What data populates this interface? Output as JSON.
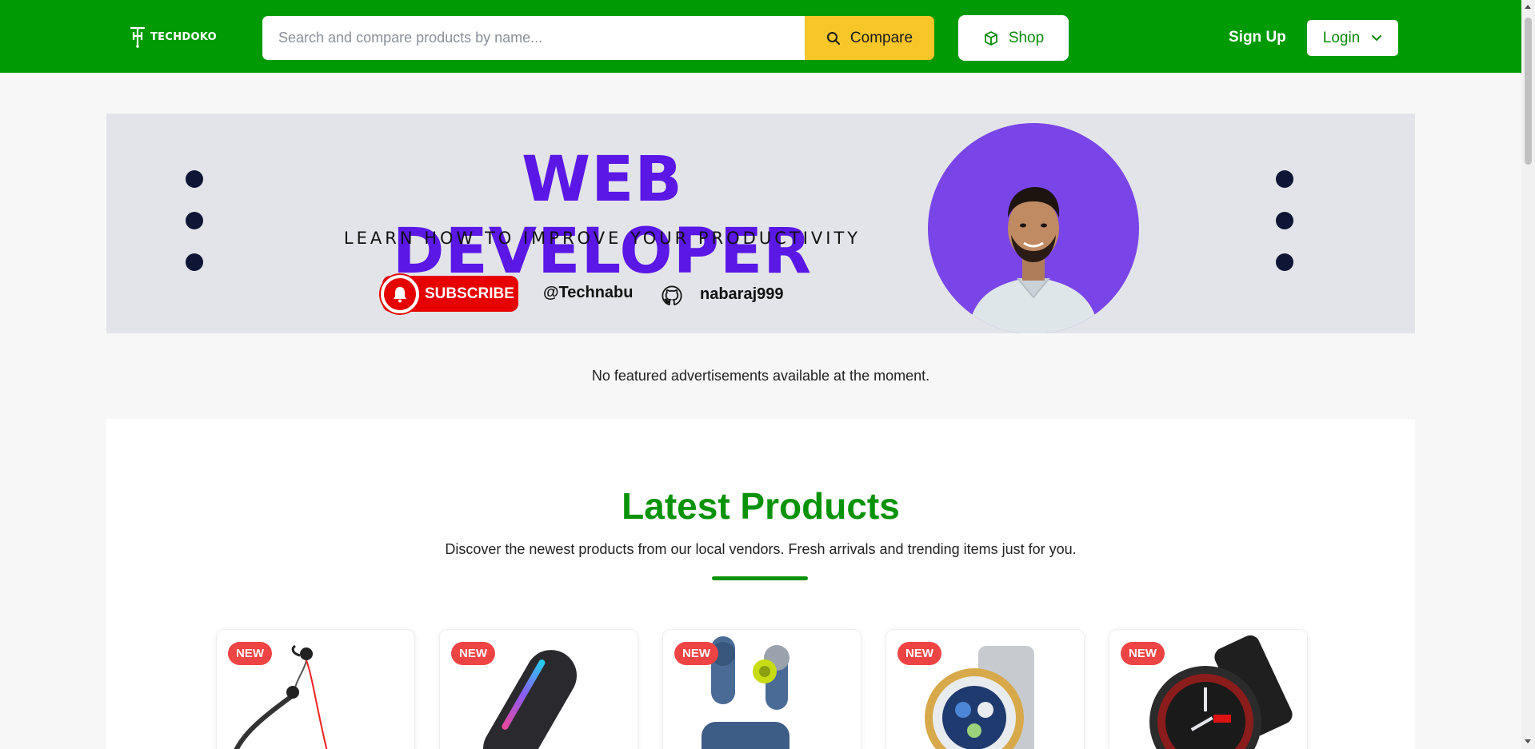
{
  "header": {
    "logo_text": "TECHDOKO",
    "search_placeholder": "Search and compare products by name...",
    "compare_label": "Compare",
    "shop_label": "Shop",
    "signup_label": "Sign Up",
    "login_label": "Login",
    "colors": {
      "header_bg": "#009a04",
      "compare_bg": "#f9c62a"
    }
  },
  "banner": {
    "title": "WEB DEVELOPER",
    "subtitle": "LEARN HOW TO IMPROVE YOUR PRODUCTIVITY",
    "subscribe_label": "SUBSCRIBE",
    "handle": "@Technabu",
    "github_name": "nabaraj999",
    "colors": {
      "title": "#5a17e6",
      "avatar_bg": "#7a45e8",
      "subscribe": "#e60000"
    }
  },
  "ads_message": "No featured advertisements available at the moment.",
  "latest": {
    "title": "Latest Products",
    "description": "Discover the newest products from our local vendors. Fresh arrivals and trending items just for you.",
    "products": [
      {
        "badge": "NEW",
        "icon": "neckband-earphones-icon"
      },
      {
        "badge": "NEW",
        "icon": "bluetooth-speaker-icon"
      },
      {
        "badge": "NEW",
        "icon": "wireless-earbuds-icon"
      },
      {
        "badge": "NEW",
        "icon": "silver-watch-icon"
      },
      {
        "badge": "NEW",
        "icon": "sport-watch-icon"
      }
    ],
    "colors": {
      "accent": "#0a930a",
      "badge": "#ef4444"
    }
  }
}
